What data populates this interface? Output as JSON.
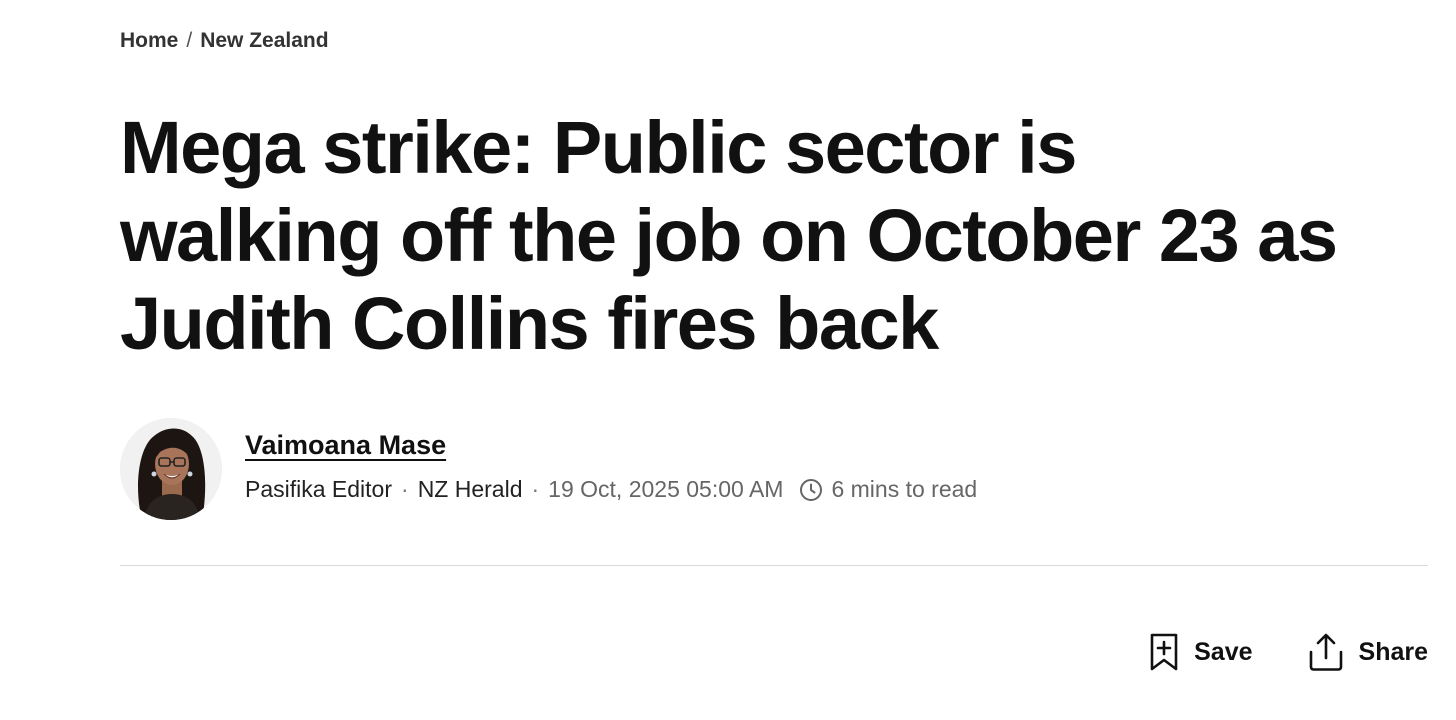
{
  "breadcrumb": {
    "items": [
      "Home",
      "New Zealand"
    ],
    "separator": "/"
  },
  "article": {
    "headline": "Mega strike: Public sector is walking off the job on October 23 as Judith Collins fires back"
  },
  "byline": {
    "author_name": "Vaimoana Mase",
    "author_role": "Pasifika Editor",
    "publication": "NZ Herald",
    "separator": "·",
    "date": "19 Oct, 2025 05:00 AM",
    "read_time": "6 mins to read",
    "read_time_icon": "clock-icon"
  },
  "actions": {
    "save_label": "Save",
    "save_icon": "bookmark-plus-icon",
    "share_label": "Share",
    "share_icon": "share-icon"
  },
  "colors": {
    "text": "#111111",
    "muted": "#666666",
    "divider": "#d9d9d9",
    "background": "#ffffff"
  }
}
